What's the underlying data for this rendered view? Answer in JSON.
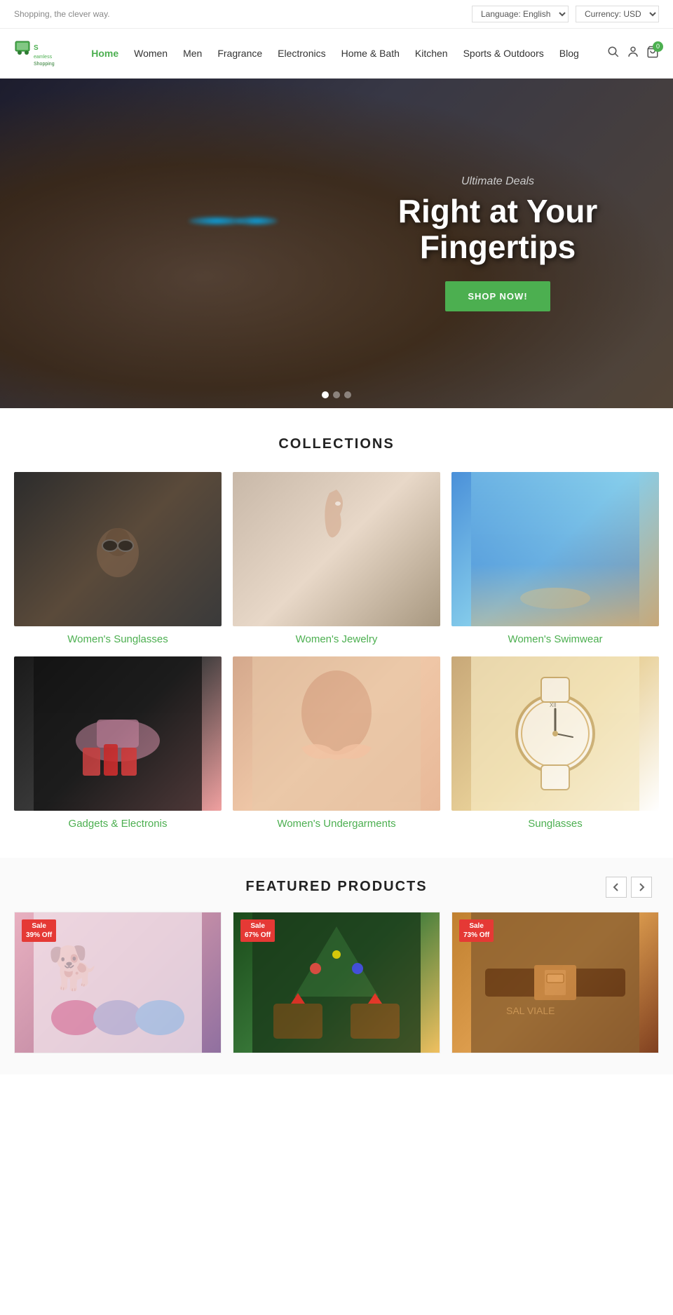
{
  "topbar": {
    "tagline": "Shopping, the clever way.",
    "language_label": "Language: English",
    "currency_label": "Currency: USD"
  },
  "header": {
    "logo_line1": "Seamless",
    "logo_line2": "Shopping",
    "nav_items": [
      {
        "label": "Home",
        "active": true
      },
      {
        "label": "Women",
        "active": false
      },
      {
        "label": "Men",
        "active": false
      },
      {
        "label": "Fragrance",
        "active": false
      },
      {
        "label": "Electronics",
        "active": false
      },
      {
        "label": "Home & Bath",
        "active": false
      },
      {
        "label": "Kitchen",
        "active": false
      },
      {
        "label": "Sports & Outdoors",
        "active": false
      },
      {
        "label": "Blog",
        "active": false
      }
    ],
    "cart_count": "0"
  },
  "hero": {
    "subtitle": "Ultimate Deals",
    "title": "Right at Your Fingertips",
    "button_label": "SHOP NOW!"
  },
  "collections": {
    "section_title": "COLLECTIONS",
    "items": [
      {
        "label": "Women's Sunglasses",
        "class": "col-sunglasses"
      },
      {
        "label": "Women's Jewelry",
        "class": "col-jewelry"
      },
      {
        "label": "Women's Swimwear",
        "class": "col-swimwear"
      },
      {
        "label": "Gadgets & Electronis",
        "class": "col-gadgets"
      },
      {
        "label": "Women's Undergarments",
        "class": "col-undergarments"
      },
      {
        "label": "Sunglasses",
        "class": "col-watches"
      }
    ]
  },
  "featured": {
    "section_title": "FEATURED PRODUCTS",
    "products": [
      {
        "badge_line1": "Sale",
        "badge_line2": "39% Off",
        "class": "prod-1"
      },
      {
        "badge_line1": "Sale",
        "badge_line2": "67% Off",
        "class": "prod-2"
      },
      {
        "badge_line1": "Sale",
        "badge_line2": "73% Off",
        "class": "prod-3"
      }
    ]
  }
}
